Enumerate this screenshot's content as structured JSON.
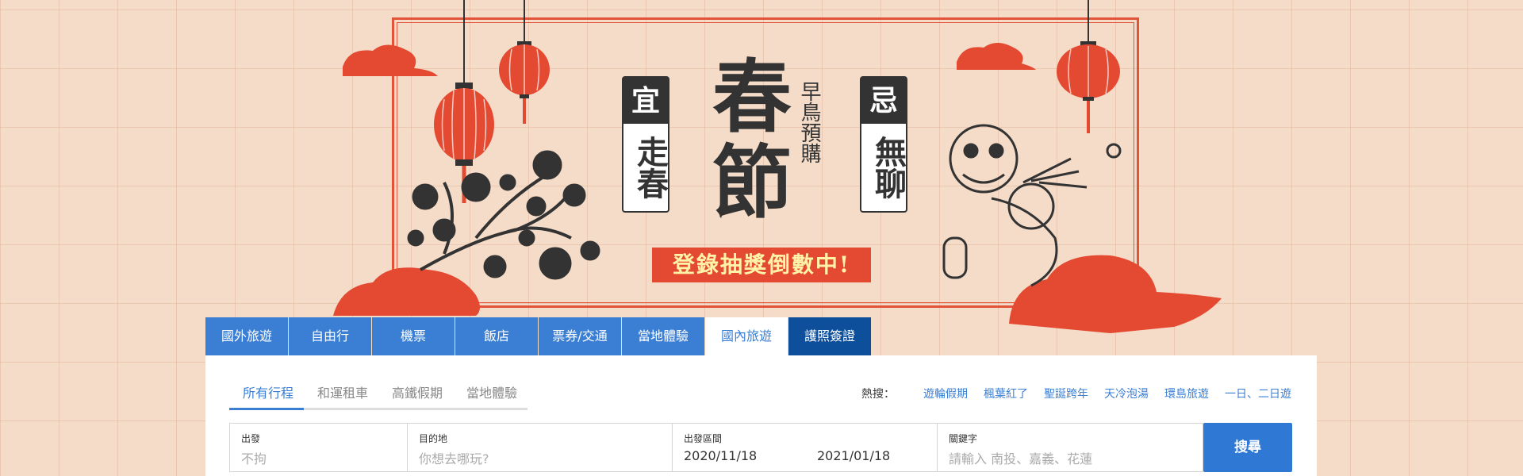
{
  "banner": {
    "yi_top": "宜",
    "yi_text": "走春",
    "ji_top": "忌",
    "ji_text": "無聊",
    "title_char1": "春",
    "title_char2": "節",
    "subtitle": "早鳥預購",
    "promo": "登錄抽獎倒數中!"
  },
  "tabs": [
    {
      "label": "國外旅遊"
    },
    {
      "label": "自由行"
    },
    {
      "label": "機票"
    },
    {
      "label": "飯店"
    },
    {
      "label": "票券/交通"
    },
    {
      "label": "當地體驗"
    },
    {
      "label": "國內旅遊"
    },
    {
      "label": "護照簽證"
    }
  ],
  "subtabs": [
    {
      "label": "所有行程"
    },
    {
      "label": "和運租車"
    },
    {
      "label": "高鐵假期"
    },
    {
      "label": "當地體驗"
    }
  ],
  "hot": {
    "label": "熱搜：",
    "links": [
      "遊輪假期",
      "楓葉紅了",
      "聖誕跨年",
      "天冷泡湯",
      "環島旅遊",
      "一日、二日遊"
    ]
  },
  "search": {
    "depart_label": "出發",
    "depart_value": "不拘",
    "dest_label": "目的地",
    "dest_placeholder": "你想去哪玩?",
    "range_label": "出發區間",
    "date_start": "2020/11/18",
    "date_end": "2021/01/18",
    "keyword_label": "關鍵字",
    "keyword_placeholder": "請輸入 南投、嘉義、花蓮",
    "button": "搜尋"
  },
  "colors": {
    "accent_red": "#e2533a",
    "tab_blue": "#3b7fd4",
    "tab_dark": "#0e4f9c",
    "banner_bg": "#f5dcc9"
  }
}
